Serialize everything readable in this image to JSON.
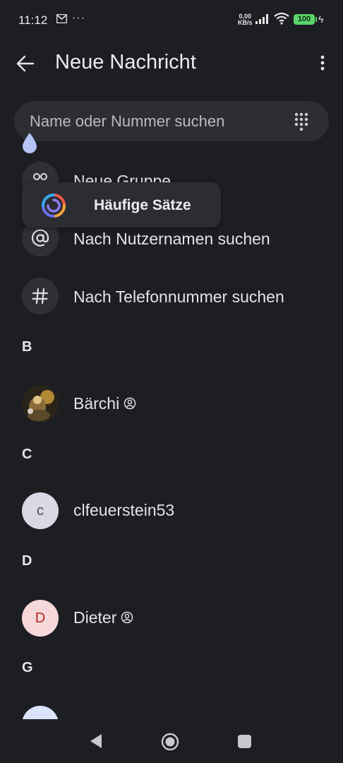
{
  "status_bar": {
    "time": "11:12",
    "more": "···",
    "speed_value": "0,00",
    "speed_unit": "KB/s",
    "battery": "100",
    "icons": [
      "mail-icon",
      "signal-icon",
      "wifi-icon",
      "battery-icon",
      "charging-icon"
    ]
  },
  "app_bar": {
    "title": "Neue Nachricht"
  },
  "search": {
    "placeholder": "Name oder Nummer suchen"
  },
  "actions": [
    {
      "label": "Neue Gruppe",
      "icon": "group-icon"
    },
    {
      "label": "Nach Nutzernamen suchen",
      "icon": "at-icon"
    },
    {
      "label": "Nach Telefonnummer suchen",
      "icon": "hash-icon"
    }
  ],
  "tooltip": {
    "text": "Häufige Sätze"
  },
  "contacts": {
    "sections": [
      "B",
      "C",
      "D",
      "G"
    ],
    "items": [
      {
        "name": "Bärchi",
        "avatar": "photo",
        "has_profile_icon": true
      },
      {
        "name": "clfeuerstein53",
        "avatar": "c",
        "avatar_bg": "#d9d9e6",
        "avatar_fg": "#4a4a5a"
      },
      {
        "name": "Dieter",
        "avatar": "D",
        "avatar_bg": "#f7d8da",
        "avatar_fg": "#b3261e",
        "has_profile_icon": true
      },
      {
        "name": "",
        "avatar": "",
        "avatar_bg": "#d9e4fb"
      }
    ]
  },
  "colors": {
    "background": "#1d1e22",
    "surface": "#2d2e33",
    "battery": "#5ad46a"
  }
}
